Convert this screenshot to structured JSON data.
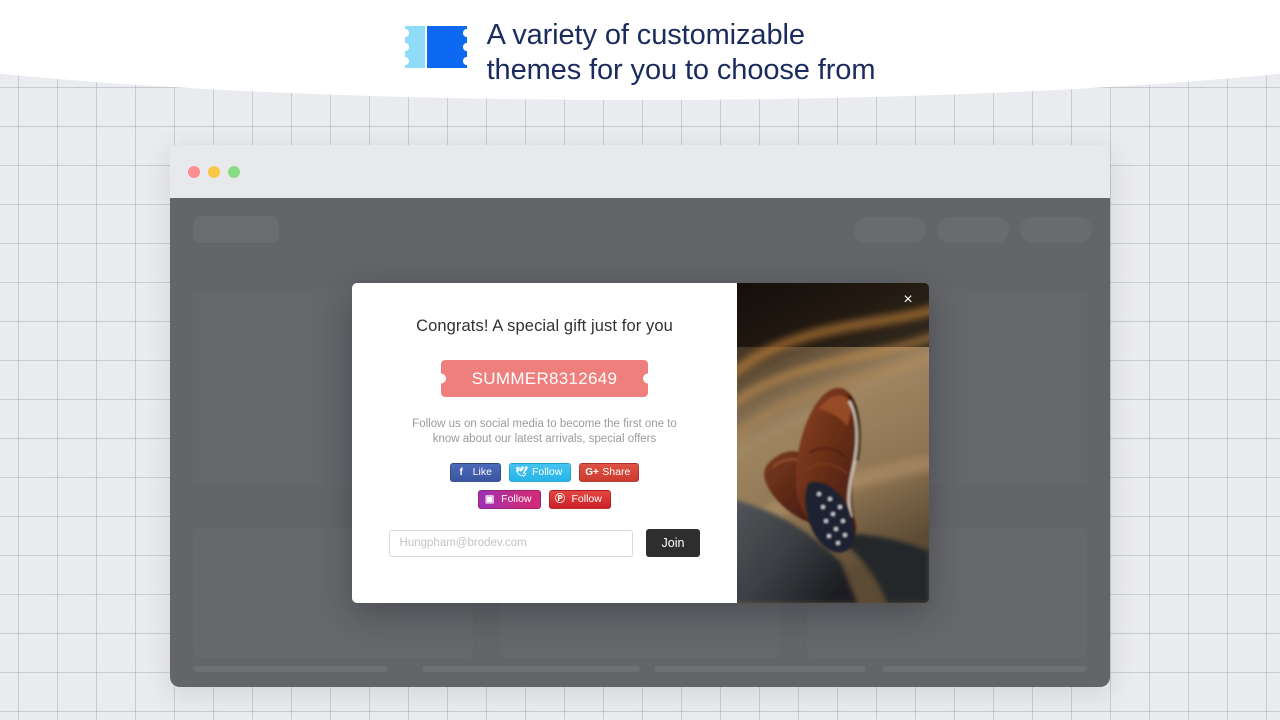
{
  "page": {
    "background_color": "#eaecef",
    "headline_color": "#1b2b5e"
  },
  "headline": {
    "icon_name": "ticket-icon",
    "line1": "A variety of customizable",
    "line2": "themes for you to choose from",
    "full_text": "A variety of customizable themes for you to choose from"
  },
  "browser": {
    "traffic_lights": [
      {
        "name": "close",
        "color": "#fd8e8f"
      },
      {
        "name": "minimize",
        "color": "#f9c846"
      },
      {
        "name": "maximize",
        "color": "#88dd84"
      }
    ],
    "skeleton": {
      "logo_placeholder": "",
      "nav_placeholders": [
        "",
        "",
        ""
      ],
      "card_placeholders": [
        "",
        "",
        ""
      ],
      "footer_lines": [
        "",
        "",
        "",
        ""
      ]
    }
  },
  "modal": {
    "title": "Congrats! A special gift just for you",
    "coupon_code": "SUMMER8312649",
    "coupon_color": "#ef7f7d",
    "subtitle": "Follow us on social media to become the first one to know about our latest arrivals, special offers",
    "close_label": "×",
    "social_row_1": [
      {
        "network": "facebook",
        "glyph": "f",
        "label": "Like",
        "color": "#3b5998"
      },
      {
        "network": "twitter",
        "glyph": "🕊",
        "label": "Follow",
        "color": "#29b5e8"
      },
      {
        "network": "googleplus",
        "glyph": "G+",
        "label": "Share",
        "color": "#db4437"
      }
    ],
    "social_row_2": [
      {
        "network": "instagram",
        "glyph": "▣",
        "label": "Follow",
        "color": "#c32aa3"
      },
      {
        "network": "pinterest",
        "glyph": "Ⓟ",
        "label": "Follow",
        "color": "#cc2127"
      }
    ],
    "email_placeholder": "Hungpham@brodev.com",
    "email_value": "",
    "join_label": "Join",
    "photo_alt": "brown leather dress shoes with polka dot socks on a road"
  }
}
